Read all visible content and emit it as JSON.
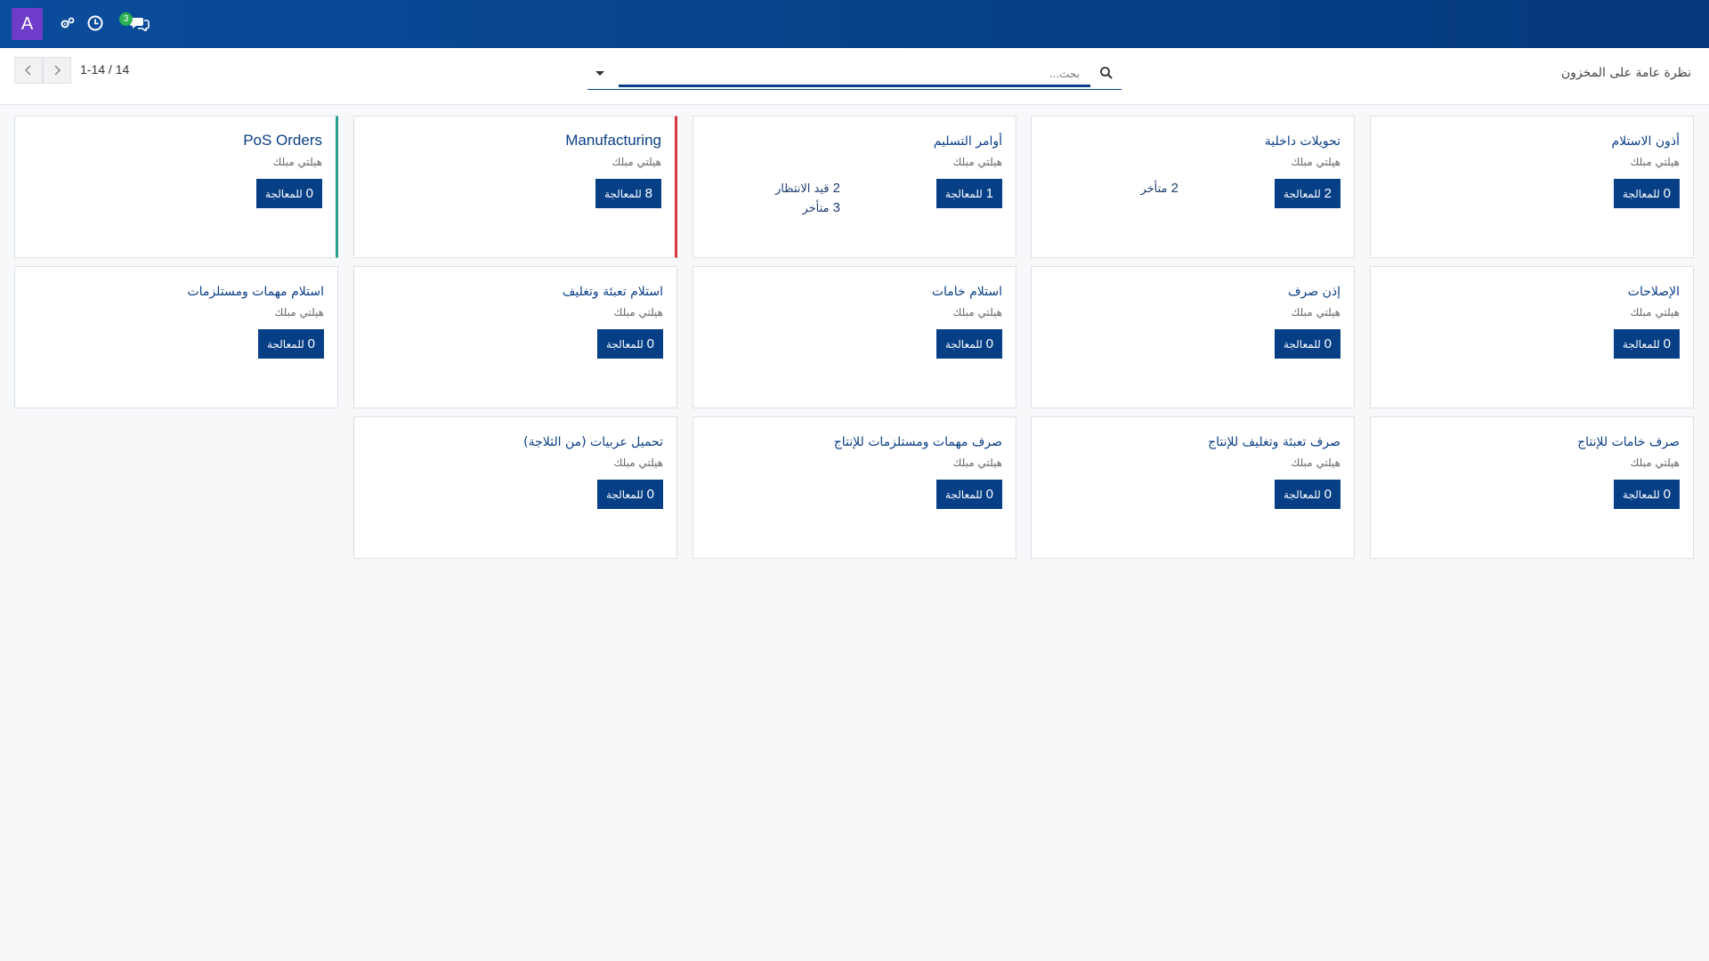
{
  "navbar": {
    "avatar_letter": "A",
    "icons": [
      "tools-icon",
      "clock-icon",
      "chat-icon"
    ],
    "messages_badge": "3"
  },
  "control_panel": {
    "breadcrumb": "نظرة عامة على المخزون",
    "search_placeholder": "بحث...",
    "pager_value": "1-14 / 14"
  },
  "cards": [
    {
      "title": "أذون الاستلام",
      "subtitle": "هيلتي مبلك",
      "button": {
        "count": "0",
        "label": "للمعالجة"
      }
    },
    {
      "title": "تحويلات داخلية",
      "subtitle": "هيلتي مبلك",
      "button": {
        "count": "2",
        "label": "للمعالجة"
      },
      "stats": [
        {
          "count": "2",
          "label": "متأخر"
        }
      ]
    },
    {
      "title": "أوامر التسليم",
      "subtitle": "هيلتي مبلك",
      "button": {
        "count": "1",
        "label": "للمعالجة"
      },
      "stats": [
        {
          "count": "2",
          "label": "قيد الانتظار"
        },
        {
          "count": "3",
          "label": "متأخر"
        }
      ]
    },
    {
      "title": "Manufacturing",
      "subtitle": "هيلتي مبلك",
      "button": {
        "count": "8",
        "label": "للمعالجة"
      },
      "accent": "#d9353f"
    },
    {
      "title": "PoS Orders",
      "subtitle": "هيلتي مبلك",
      "button": {
        "count": "0",
        "label": "للمعالجة"
      },
      "accent": "#27a18e"
    },
    {
      "title": "الإصلاحات",
      "subtitle": "هيلتي مبلك",
      "button": {
        "count": "0",
        "label": "للمعالجة"
      }
    },
    {
      "title": "إذن صرف",
      "subtitle": "هيلتي مبلك",
      "button": {
        "count": "0",
        "label": "للمعالجة"
      }
    },
    {
      "title": "استلام خامات",
      "subtitle": "هيلتي مبلك",
      "button": {
        "count": "0",
        "label": "للمعالجة"
      }
    },
    {
      "title": "استلام تعبئة وتغليف",
      "subtitle": "هيلتي مبلك",
      "button": {
        "count": "0",
        "label": "للمعالجة"
      }
    },
    {
      "title": "استلام مهمات ومستلزمات",
      "subtitle": "هيلتي مبلك",
      "button": {
        "count": "0",
        "label": "للمعالجة"
      }
    },
    {
      "title": "صرف خامات للإنتاج",
      "subtitle": "هيلتي مبلك",
      "button": {
        "count": "0",
        "label": "للمعالجة"
      }
    },
    {
      "title": "صرف تعبئة وتغليف للإنتاج",
      "subtitle": "هيلتي مبلك",
      "button": {
        "count": "0",
        "label": "للمعالجة"
      }
    },
    {
      "title": "صرف مهمات ومستلزمات للإنتاج",
      "subtitle": "هيلتي مبلك",
      "button": {
        "count": "0",
        "label": "للمعالجة"
      }
    },
    {
      "title": "تحميل عربيات (من الثلاجة)",
      "subtitle": "هيلتي مبلك",
      "button": {
        "count": "0",
        "label": "للمعالجة"
      }
    }
  ],
  "colors": {
    "navbar": "#0a4d9c",
    "primary": "#063f86",
    "avatar": "#6e3cc8",
    "badge": "#2bb04f",
    "accent_green": "#27a18e",
    "accent_red": "#d9353f"
  }
}
